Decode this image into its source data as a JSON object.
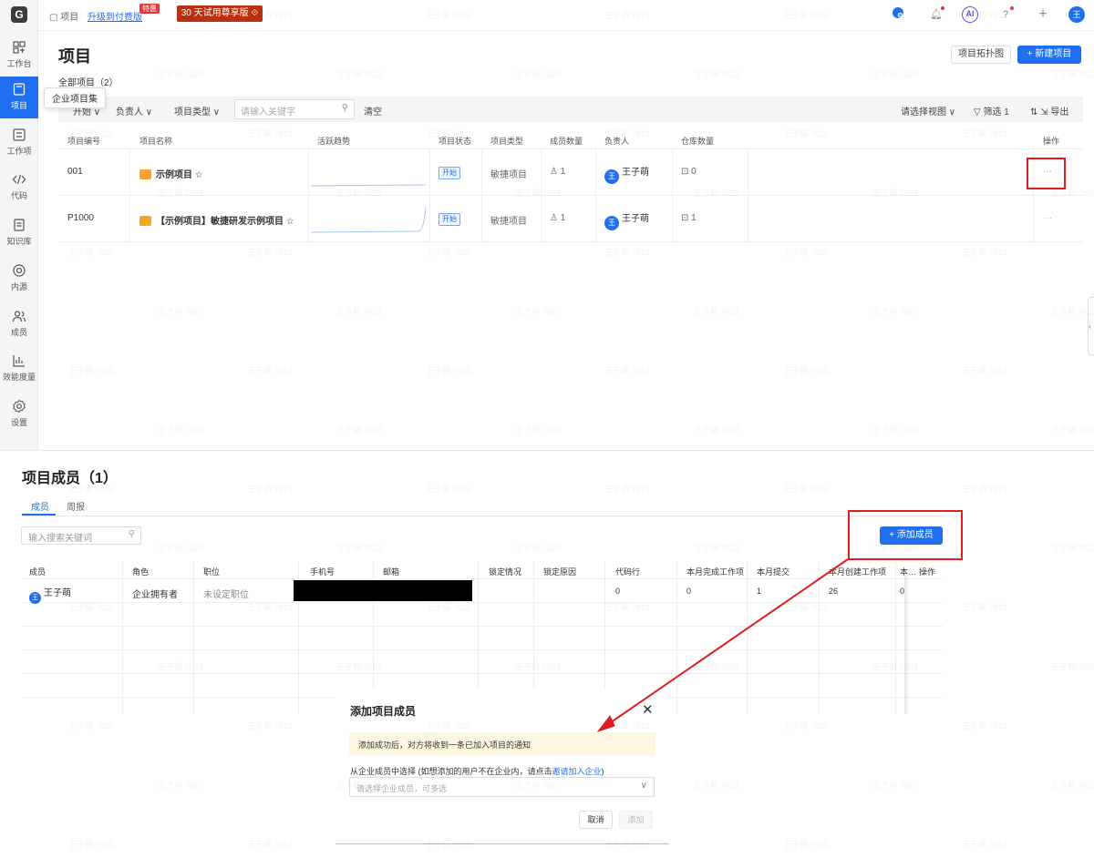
{
  "app": {
    "logo_letter": "G"
  },
  "sidebar": {
    "items": [
      {
        "label": "工作台"
      },
      {
        "label": "项目"
      },
      {
        "label": "工作项"
      },
      {
        "label": "代码"
      },
      {
        "label": "知识库"
      },
      {
        "label": "内源"
      },
      {
        "label": "成员"
      },
      {
        "label": "效能度量"
      },
      {
        "label": "设置"
      }
    ]
  },
  "topbar": {
    "breadcrumb": "项目",
    "upgrade_link": "升级到付费版",
    "sale_badge": "特惠",
    "trial_button": "30 天试用尊享版 ⟐",
    "ai_label": "AI",
    "help_label": "?",
    "avatar_initial": "王"
  },
  "projects_page": {
    "title": "项目",
    "topology_button": "项目拓扑图",
    "new_button": "+ 新建项目",
    "all_projects": "全部项目（2）",
    "tooltip": "企业项目集",
    "filters": {
      "status": "开始 ∨",
      "owner": "负责人 ∨",
      "type": "项目类型 ∨",
      "search_placeholder": "请输入关键字",
      "clear": "清空",
      "view": "请选择视图 ∨",
      "filter": "▽ 筛选  1",
      "export": "⇅   ⇲ 导出"
    },
    "columns": [
      "项目编号",
      "项目名称",
      "活跃趋势",
      "项目状态",
      "项目类型",
      "成员数量",
      "负责人",
      "仓库数量",
      "操作"
    ],
    "rows": [
      {
        "id": "001",
        "name": "示例项目 ☆",
        "status": "开始",
        "type": "敏捷项目",
        "members": "1",
        "owner": "王子萌",
        "owner_initial": "王",
        "repos": "0",
        "more": "···"
      },
      {
        "id": "P1000",
        "name": "【示例项目】敏捷研发示例项目 ☆",
        "status": "开始",
        "type": "敏捷项目",
        "members": "1",
        "owner": "王子萌",
        "owner_initial": "王",
        "repos": "1",
        "more": "···"
      }
    ]
  },
  "members_page": {
    "title": "项目成员（1）",
    "tabs": [
      "成员",
      "周报"
    ],
    "search_placeholder": "输入搜索关键词",
    "add_button": "+ 添加成员",
    "columns": [
      "成员",
      "角色",
      "职位",
      "手机号",
      "邮箱",
      "锁定情况",
      "锁定原因",
      "代码行",
      "本月完成工作项",
      "本月提交",
      "本月创建工作项",
      "本…",
      "操作"
    ],
    "rows": [
      {
        "name": "王子萌",
        "initial": "王",
        "role": "企业拥有者",
        "position": "未设定职位",
        "code_lines": "0",
        "done_items": "0",
        "commits": "1",
        "created_items": "26",
        "extra": "0"
      }
    ]
  },
  "dialog": {
    "title": "添加项目成员",
    "close_icon": "✕",
    "notice": "添加成功后，对方将收到一条已加入项目的通知",
    "label_prefix": "从企业成员中选择 (如想添加的用户不在企业内，请点击",
    "label_link": "邀请加入企业",
    "label_suffix": ")",
    "select_placeholder": "请选择企业成员，可多选",
    "cancel": "取消",
    "confirm": "添加"
  },
  "colors": {
    "accent": "#1f6ff0",
    "highlight": "#e01e1e",
    "notice_bg": "#fdf6e0"
  },
  "watermark": "王子萌 7623"
}
